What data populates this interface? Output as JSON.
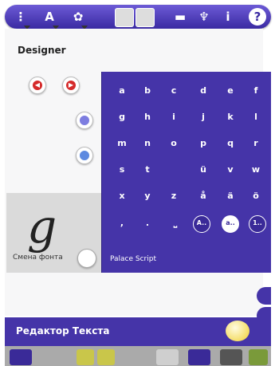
{
  "toolbar": {
    "icons": [
      "sequence-icon",
      "font-icon",
      "embroidery-icon",
      "layout-icon",
      "camera-icon",
      "folder-icon",
      "settings-icon",
      "info-icon",
      "help-icon"
    ],
    "info_label": "i",
    "help_label": "?"
  },
  "editor": {
    "title": "Designer",
    "font_change_label": "Смена фонта",
    "font_name": "Palace Script",
    "glyph_preview": "g"
  },
  "keyboard": {
    "rows": [
      [
        "a",
        "b",
        "c",
        "d",
        "e",
        "f"
      ],
      [
        "g",
        "h",
        "i",
        "j",
        "k",
        "l"
      ],
      [
        "m",
        "n",
        "o",
        "p",
        "q",
        "r"
      ],
      [
        "s",
        "t",
        "ü",
        "v",
        "w"
      ],
      [
        "x",
        "y",
        "z",
        "å",
        "ä",
        "ö"
      ],
      [
        ",",
        ".",
        "⎵"
      ]
    ],
    "mode_keys": [
      "A..",
      "a..",
      "1.."
    ],
    "selected_mode": "a.."
  },
  "bottom_bar": {
    "title": "Редактор Текста"
  },
  "colors": {
    "accent": "#4534a8",
    "toolbar": "#3a2aa2",
    "confirm": "#f0d030",
    "delete": "#d52a2a"
  }
}
